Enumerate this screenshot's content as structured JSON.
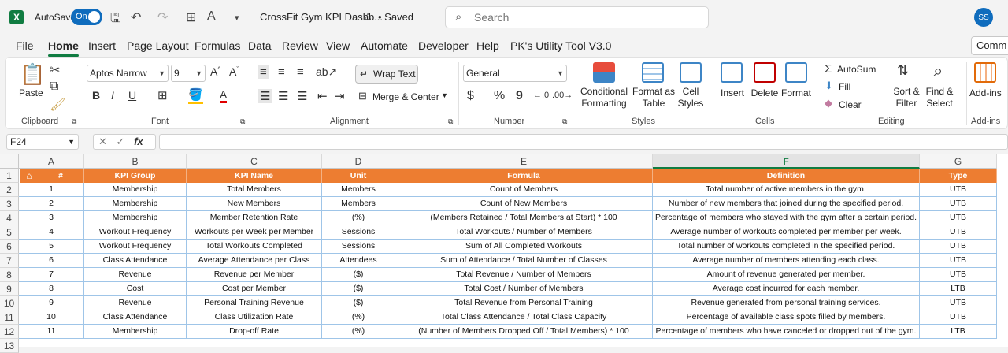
{
  "titlebar": {
    "app_logo": "X",
    "autosave_label": "AutoSave",
    "autosave_state": "On",
    "doc_title": "CrossFit Gym KPI Dashb...",
    "saved_label": "• Saved",
    "search_placeholder": "Search",
    "avatar_initials": "SS"
  },
  "menu": {
    "items": [
      "File",
      "Home",
      "Insert",
      "Page Layout",
      "Formulas",
      "Data",
      "Review",
      "View",
      "Automate",
      "Developer",
      "Help",
      "PK's Utility Tool V3.0"
    ],
    "active": "Home",
    "comments_label": "Comm"
  },
  "ribbon": {
    "clipboard": {
      "paste": "Paste",
      "label": "Clipboard"
    },
    "font": {
      "name": "Aptos Narrow",
      "size": "9",
      "bold": "B",
      "italic": "I",
      "underline": "U",
      "label": "Font"
    },
    "alignment": {
      "wrap": "Wrap Text",
      "merge": "Merge & Center",
      "label": "Alignment"
    },
    "number": {
      "format": "General",
      "currency": "$",
      "percent": "%",
      "comma": "9",
      "label": "Number"
    },
    "styles": {
      "conditional": "Conditional",
      "formatting": "Formatting",
      "format_as": "Format as",
      "table": "Table",
      "cell": "Cell",
      "styles": "Styles",
      "label": "Styles"
    },
    "cells": {
      "insert": "Insert",
      "delete": "Delete",
      "format": "Format",
      "label": "Cells"
    },
    "editing": {
      "autosum": "AutoSum",
      "fill": "Fill",
      "clear": "Clear",
      "sort": "Sort &",
      "filter": "Filter",
      "find": "Find &",
      "select": "Select",
      "label": "Editing"
    },
    "addins": {
      "name": "Add-ins",
      "label": "Add-ins"
    }
  },
  "formula_bar": {
    "name_box": "F24",
    "fx": "fx",
    "value": ""
  },
  "columns": [
    "A",
    "B",
    "C",
    "D",
    "E",
    "F",
    "G"
  ],
  "selected_column": "F",
  "rows": [
    "1",
    "2",
    "3",
    "4",
    "5",
    "6",
    "7",
    "8",
    "9",
    "10",
    "11",
    "12",
    "13"
  ],
  "table": {
    "headers": [
      "#",
      "KPI Group",
      "KPI Name",
      "Unit",
      "Formula",
      "Definition",
      "Type"
    ],
    "data": [
      [
        "1",
        "Membership",
        "Total Members",
        "Members",
        "Count of Members",
        "Total number of active members in the gym.",
        "UTB"
      ],
      [
        "2",
        "Membership",
        "New Members",
        "Members",
        "Count of New Members",
        "Number of new members that joined during the specified period.",
        "UTB"
      ],
      [
        "3",
        "Membership",
        "Member Retention Rate",
        "(%)",
        "(Members Retained / Total Members at Start) * 100",
        "Percentage of members who stayed with the gym after a certain period.",
        "UTB"
      ],
      [
        "4",
        "Workout Frequency",
        "Workouts per Week per Member",
        "Sessions",
        "Total Workouts / Number of Members",
        "Average number of workouts completed per member per week.",
        "UTB"
      ],
      [
        "5",
        "Workout Frequency",
        "Total Workouts Completed",
        "Sessions",
        "Sum of All Completed Workouts",
        "Total number of workouts completed in the specified period.",
        "UTB"
      ],
      [
        "6",
        "Class Attendance",
        "Average Attendance per Class",
        "Attendees",
        "Sum of Attendance / Total Number of Classes",
        "Average number of members attending each class.",
        "UTB"
      ],
      [
        "7",
        "Revenue",
        "Revenue per Member",
        "($)",
        "Total Revenue / Number of Members",
        "Amount of revenue generated per member.",
        "UTB"
      ],
      [
        "8",
        "Cost",
        "Cost per Member",
        "($)",
        "Total Cost / Number of Members",
        "Average cost incurred for each member.",
        "LTB"
      ],
      [
        "9",
        "Revenue",
        "Personal Training Revenue",
        "($)",
        "Total Revenue from Personal Training",
        "Revenue generated from personal training services.",
        "UTB"
      ],
      [
        "10",
        "Class Attendance",
        "Class Utilization Rate",
        "(%)",
        "Total Class Attendance / Total Class Capacity",
        "Percentage of available class spots filled by members.",
        "UTB"
      ],
      [
        "11",
        "Membership",
        "Drop-off Rate",
        "(%)",
        "(Number of Members Dropped Off / Total Members) * 100",
        "Percentage of members who have canceled or dropped out of the gym.",
        "LTB"
      ]
    ]
  },
  "colors": {
    "header_fill": "#ed7d31",
    "accent": "#107c41",
    "border": "#9fc5e8"
  },
  "icons": [
    "excel-logo-icon",
    "save-icon",
    "undo-icon",
    "redo-icon",
    "search-icon",
    "home-icon",
    "cut-icon",
    "copy-icon",
    "format-painter-icon"
  ]
}
